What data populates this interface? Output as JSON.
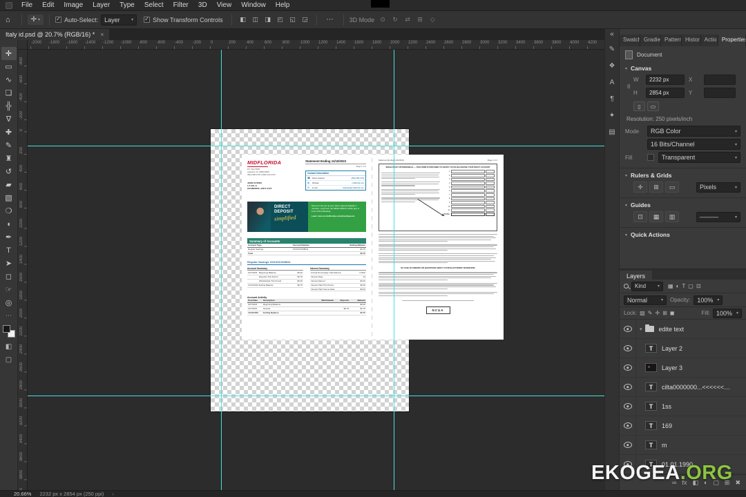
{
  "menu": {
    "items": [
      "File",
      "Edit",
      "Image",
      "Layer",
      "Type",
      "Select",
      "Filter",
      "3D",
      "View",
      "Window",
      "Help"
    ]
  },
  "options_bar": {
    "move_tool_glyph": "✛",
    "auto_select_label": "Auto-Select:",
    "auto_select_value": "Layer",
    "show_transform_label": "Show Transform Controls",
    "more_glyph": "⋯",
    "mode_3d_label": "3D Mode",
    "align_icons": [
      {
        "name": "align-left-icon",
        "glyph": "◧"
      },
      {
        "name": "align-center-horizontal-icon",
        "glyph": "◫"
      },
      {
        "name": "align-right-icon",
        "glyph": "◨"
      },
      {
        "name": "align-top-icon",
        "glyph": "◰"
      },
      {
        "name": "align-middle-icon",
        "glyph": "◱"
      },
      {
        "name": "align-bottom-icon",
        "glyph": "◲"
      }
    ],
    "threed_icons": [
      {
        "name": "3d-rotate-icon",
        "glyph": "⊙"
      },
      {
        "name": "3d-roll-icon",
        "glyph": "↻"
      },
      {
        "name": "3d-drag-icon",
        "glyph": "⇄"
      },
      {
        "name": "3d-slide-icon",
        "glyph": "⊞"
      },
      {
        "name": "3d-scale-icon",
        "glyph": "◇"
      }
    ]
  },
  "document_tab": {
    "title": "Italy id.psd @ 20.7% (RGB/16) *",
    "close_glyph": "×"
  },
  "toolbar": {
    "more_glyph": "⋯",
    "quick_mask_glyph": "◧",
    "screen_mode_glyph": "▢",
    "tools": [
      {
        "name": "move-tool",
        "glyph": "✛",
        "active": true
      },
      {
        "name": "marquee-tool",
        "glyph": "▭"
      },
      {
        "name": "lasso-tool",
        "glyph": "∿"
      },
      {
        "name": "object-selection-tool",
        "glyph": "❏"
      },
      {
        "name": "crop-tool",
        "glyph": "╬"
      },
      {
        "name": "eyedropper-tool",
        "glyph": "∇"
      },
      {
        "name": "healing-brush-tool",
        "glyph": "✚"
      },
      {
        "name": "brush-tool",
        "glyph": "✎"
      },
      {
        "name": "clone-stamp-tool",
        "glyph": "♜"
      },
      {
        "name": "history-brush-tool",
        "glyph": "↺"
      },
      {
        "name": "eraser-tool",
        "glyph": "▰"
      },
      {
        "name": "gradient-tool",
        "glyph": "▧"
      },
      {
        "name": "blur-tool",
        "glyph": "❍"
      },
      {
        "name": "dodge-tool",
        "glyph": "◖"
      },
      {
        "name": "pen-tool",
        "glyph": "✒"
      },
      {
        "name": "type-tool",
        "glyph": "T"
      },
      {
        "name": "path-selection-tool",
        "glyph": "➤"
      },
      {
        "name": "shape-tool",
        "glyph": "◻"
      },
      {
        "name": "hand-tool",
        "glyph": "☞"
      },
      {
        "name": "zoom-tool",
        "glyph": "◎"
      }
    ]
  },
  "rulers": {
    "horizontal": {
      "start": -2000,
      "step": 200,
      "count": 32
    },
    "vertical": {
      "start": -800,
      "step": 200,
      "count": 25
    }
  },
  "right_strip": {
    "collapse_glyph": "«",
    "icons": [
      {
        "name": "brushes-panel-icon",
        "glyph": "✎"
      },
      {
        "name": "libraries-panel-icon",
        "glyph": "❖"
      },
      {
        "name": "character-panel-icon",
        "glyph": "A"
      },
      {
        "name": "paragraph-panel-icon",
        "glyph": "¶"
      },
      {
        "name": "glyphs-panel-icon",
        "glyph": "✦"
      },
      {
        "name": "adjustments-panel-icon",
        "glyph": "▤"
      }
    ]
  },
  "right_panel": {
    "tabs": [
      {
        "label": "Swatches"
      },
      {
        "label": "Gradients"
      },
      {
        "label": "Patterns"
      },
      {
        "label": "Histor"
      },
      {
        "label": "Actio"
      },
      {
        "label": "Properties",
        "active": true
      }
    ],
    "properties": {
      "document_label": "Document",
      "canvas_section": "Canvas",
      "w_label": "W",
      "w_value": "2232 px",
      "x_label": "X",
      "h_label": "H",
      "h_value": "2854 px",
      "y_label": "Y",
      "link_glyph": "8",
      "portrait_glyph": "▯",
      "landscape_glyph": "▭",
      "resolution": "Resolution: 250 pixels/inch",
      "mode_label": "Mode",
      "mode_value": "RGB Color",
      "bits_value": "16 Bits/Channel",
      "fill_label": "Fill",
      "fill_value": "Transparent",
      "rulers_section": "Rulers & Grids",
      "ruler_units": "Pixels",
      "ruler_icons": [
        {
          "name": "ruler-icon",
          "glyph": "▭"
        },
        {
          "name": "grid-icon",
          "glyph": "⊞"
        },
        {
          "name": "snap-icon",
          "glyph": "✛"
        }
      ],
      "guides_section": "Guides",
      "guide_icons": [
        {
          "name": "new-guide-icon",
          "glyph": "▥"
        },
        {
          "name": "guide-layout-icon",
          "glyph": "▦"
        },
        {
          "name": "lock-guides-icon",
          "glyph": "⊡"
        }
      ],
      "guide_style": "———",
      "quick_actions_section": "Quick Actions",
      "chevron": "▾"
    },
    "layers": {
      "tab_label": "Layers",
      "filter_label": "Kind",
      "filter_icons": [
        {
          "name": "filter-pixel-layers-icon",
          "glyph": "▦"
        },
        {
          "name": "filter-adjustment-layers-icon",
          "glyph": "◐"
        },
        {
          "name": "filter-type-layers-icon",
          "glyph": "T"
        },
        {
          "name": "filter-shape-layers-icon",
          "glyph": "▢"
        },
        {
          "name": "filter-smart-objects-icon",
          "glyph": "⊡"
        }
      ],
      "blend_mode": "Normal",
      "opacity_label": "Opacity:",
      "opacity_value": "100%",
      "lock_label": "Lock:",
      "lock_icons": [
        {
          "name": "lock-transparency-icon",
          "glyph": "▨"
        },
        {
          "name": "lock-pixels-icon",
          "glyph": "✎"
        },
        {
          "name": "lock-position-icon",
          "glyph": "✛"
        },
        {
          "name": "lock-artboard-icon",
          "glyph": "⊞"
        },
        {
          "name": "lock-all-icon",
          "glyph": "◼"
        }
      ],
      "fill_label": "Fill:",
      "fill_value": "100%",
      "items": [
        {
          "type": "group",
          "name": "edite text",
          "visible": true,
          "expanded": true
        },
        {
          "type": "text",
          "name": "Layer 2",
          "visible": true
        },
        {
          "type": "image",
          "name": "Layer 3",
          "visible": true
        },
        {
          "type": "text",
          "name": "cilta0000000...<<<<<<<<0 d",
          "visible": true
        },
        {
          "type": "text",
          "name": "1ss",
          "visible": true
        },
        {
          "type": "text",
          "name": "169",
          "visible": true
        },
        {
          "type": "text",
          "name": "m",
          "visible": true
        },
        {
          "type": "text",
          "name": "01.01.1990",
          "visible": true
        }
      ],
      "footer_icons": [
        {
          "name": "link-layers-icon",
          "glyph": "∞"
        },
        {
          "name": "layer-effects-icon",
          "glyph": "fx"
        },
        {
          "name": "layer-mask-icon",
          "glyph": "◧"
        },
        {
          "name": "adjustment-layer-icon",
          "glyph": "◐"
        },
        {
          "name": "layer-group-icon",
          "glyph": "▢"
        },
        {
          "name": "new-layer-icon",
          "glyph": "⊞"
        },
        {
          "name": "delete-layer-icon",
          "glyph": "✖"
        }
      ]
    }
  },
  "statement": {
    "page1": {
      "bank_name": "MIDFLORIDA",
      "statement_ending": "Statement Ending 11/10/2023",
      "page_label": "Page 1 of 4",
      "bank_address": [
        "P.O. Box 8008",
        "Lakeland, FL 33802-8008",
        "(863) 688-3733 | (866) 913-3733"
      ],
      "recipient": [
        "JOHN CITIZEN",
        "1 S VAL E",
        "OCOMONTE, 34677-4173"
      ],
      "contact_box": {
        "title": "Contact Information",
        "rows": [
          {
            "icon": "phone-icon",
            "glyph": "☎",
            "label": "Direct Inquiries",
            "value": "(863) 688-3733"
          },
          {
            "icon": "globe-icon",
            "glyph": "◍",
            "label": "Website",
            "value": "midflorida.com"
          },
          {
            "icon": "mail-icon",
            "glyph": "✉",
            "label": "E-mail",
            "value": "helpdesk@midflorida.com"
          }
        ]
      },
      "banner": {
        "line1": "DIRECT",
        "line2": "DEPOSIT",
        "script": "simplified",
        "body": "Now you can set up your direct deposit digitally in minutes—right from the MIDFLORIDA mobile app or Free Online Banking.",
        "cta": "Learn more at midflorida.com/directdeposit."
      },
      "summary": {
        "title": "Summary of Accounts",
        "columns": [
          "Account Type",
          "Account Number",
          "Ending Balance"
        ],
        "rows": [
          [
            "Regular Savings",
            "XXXXXXXX8541",
            "$0.75"
          ],
          [
            "Total",
            "",
            "$0.75"
          ]
        ]
      },
      "account_heading": "Regular Savings XXXXXXXX8541",
      "account_summary": {
        "title": "Account Summary",
        "rows": [
          [
            "10/7/2023",
            "Beginning Balance",
            "$0.00"
          ],
          [
            "",
            "Deposits This Period",
            "$0.75"
          ],
          [
            "",
            "Withdrawals This Period",
            "$0.00"
          ],
          [
            "11/10/2023",
            "Ending Balance",
            "$0.75"
          ]
        ]
      },
      "interest_summary": {
        "title": "Interest Summary",
        "rows": [
          [
            "Annual Percentage Yield Earned",
            "0.00%"
          ],
          [
            "Interest Days",
            "34"
          ],
          [
            "Interest Earned",
            "$0.00"
          ],
          [
            "Interest Paid This Period",
            "$0.00"
          ],
          [
            "Interest Paid Year-to-Date",
            "$0.00"
          ]
        ]
      },
      "activity": {
        "title": "Account Activity",
        "columns": [
          "Post Date",
          "Description",
          "Withdrawals",
          "Deposits",
          "Balance"
        ],
        "rows": [
          [
            "10/7/2023",
            "Beginning Balance",
            "",
            "",
            "$0.00"
          ],
          [
            "11/7/2023",
            "Deposit",
            "",
            "$0.75",
            "$0.75"
          ],
          [
            "11/10/2023",
            "Ending Balance",
            "",
            "",
            "$0.75"
          ]
        ]
      }
    },
    "page2": {
      "header_left": "Statement Ending 11/10/2023",
      "header_right": "Page 2 of 4",
      "worksheet_title": "IMAGE DRAFT WITHDRAWALS — THIS FORM IS PROVIDED TO ASSIST YOU IN BALANCING YOUR DRAFT ACCOUNT",
      "worksheet_rows": 11,
      "total_label": "TOTAL",
      "ws_left_blocks": [
        4,
        3,
        4,
        3
      ],
      "blocks": [
        5,
        4,
        6
      ],
      "heading": "IN CASE OF ERRORS OR QUESTIONS ABOUT YOUR ELECTRONIC TRANSFERS",
      "blocks2": [
        5,
        4,
        3
      ],
      "ncua_label": "NCUA"
    }
  },
  "status_bar": {
    "zoom": "20.66%",
    "doc_size": "2232 px x 2854 px (250 ppi)",
    "caret": "›"
  },
  "watermark": {
    "white": "EKOGEA",
    "green": ".ORG"
  }
}
